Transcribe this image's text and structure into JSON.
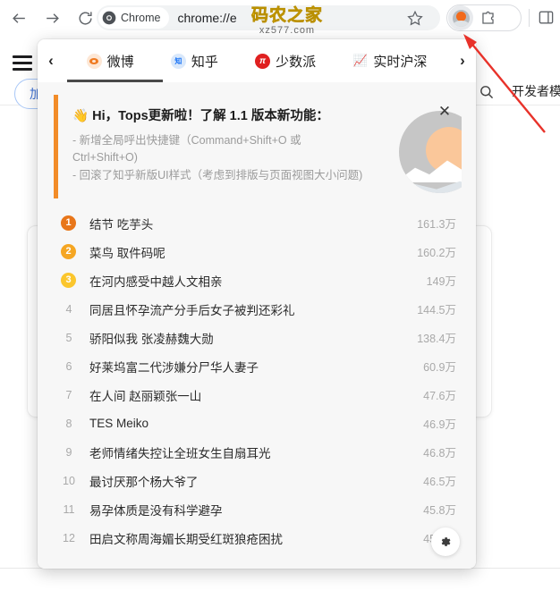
{
  "browser": {
    "back_icon": "back-arrow-icon",
    "forward_icon": "forward-arrow-icon",
    "reload_icon": "reload-icon",
    "chrome_chip_label": "Chrome",
    "url": "chrome://e",
    "star_icon": "bookmark-star-icon",
    "extension_icon": "tops-extension-icon",
    "puzzle_icon": "extensions-puzzle-icon",
    "sidepanel_icon": "side-panel-icon"
  },
  "watermark": {
    "main": "码农之家",
    "sub": "xz577.com"
  },
  "page": {
    "menu_icon": "hamburger-menu-icon",
    "pill_label": "加",
    "search_icon": "search-icon",
    "devmode_label": "开发者模"
  },
  "panel": {
    "prev_arrow": "‹",
    "next_arrow": "›",
    "tabs": [
      {
        "label": "微博",
        "icon": "weibo-icon",
        "active": true
      },
      {
        "label": "知乎",
        "icon": "zhihu-icon",
        "active": false
      },
      {
        "label": "少数派",
        "icon": "sspai-icon",
        "active": false
      },
      {
        "label": "实时沪深",
        "icon": "stock-chart-icon",
        "active": false
      }
    ],
    "banner": {
      "emoji": "👋",
      "title": "Hi，Tops更新啦！了解 1.1 版本新功能：",
      "line1": "- 新增全局呼出快捷键（Command+Shift+O 或 Ctrl+Shift+O)",
      "line2": "- 回滚了知乎新版UI样式（考虑到排版与页面视图大小问题)",
      "close_icon": "close-icon",
      "logo_icon": "tops-logo-icon",
      "accent_color": "#f28c28"
    },
    "list": [
      {
        "rank": "1",
        "title": "结节 吃芋头",
        "hot": "161.3万"
      },
      {
        "rank": "2",
        "title": "菜鸟 取件码呢",
        "hot": "160.2万"
      },
      {
        "rank": "3",
        "title": "在河内感受中越人文相亲",
        "hot": "149万"
      },
      {
        "rank": "4",
        "title": "同居且怀孕流产分手后女子被判还彩礼",
        "hot": "144.5万"
      },
      {
        "rank": "5",
        "title": "骄阳似我 张凌赫魏大勋",
        "hot": "138.4万"
      },
      {
        "rank": "6",
        "title": "好莱坞富二代涉嫌分尸华人妻子",
        "hot": "60.9万"
      },
      {
        "rank": "7",
        "title": "在人间 赵丽颖张一山",
        "hot": "47.6万"
      },
      {
        "rank": "8",
        "title": "TES Meiko",
        "hot": "46.9万"
      },
      {
        "rank": "9",
        "title": "老师情绪失控让全班女生自扇耳光",
        "hot": "46.8万"
      },
      {
        "rank": "10",
        "title": "最讨厌那个杨大爷了",
        "hot": "46.5万"
      },
      {
        "rank": "11",
        "title": "易孕体质是没有科学避孕",
        "hot": "45.8万"
      },
      {
        "rank": "12",
        "title": "田启文称周海媚长期受红斑狼疮困扰",
        "hot": "45.1万"
      }
    ],
    "gear_icon": "settings-gear-icon"
  },
  "annotation": {
    "arrow_color": "#e8322a",
    "arrow_icon": "pointer-arrow-annotation"
  }
}
